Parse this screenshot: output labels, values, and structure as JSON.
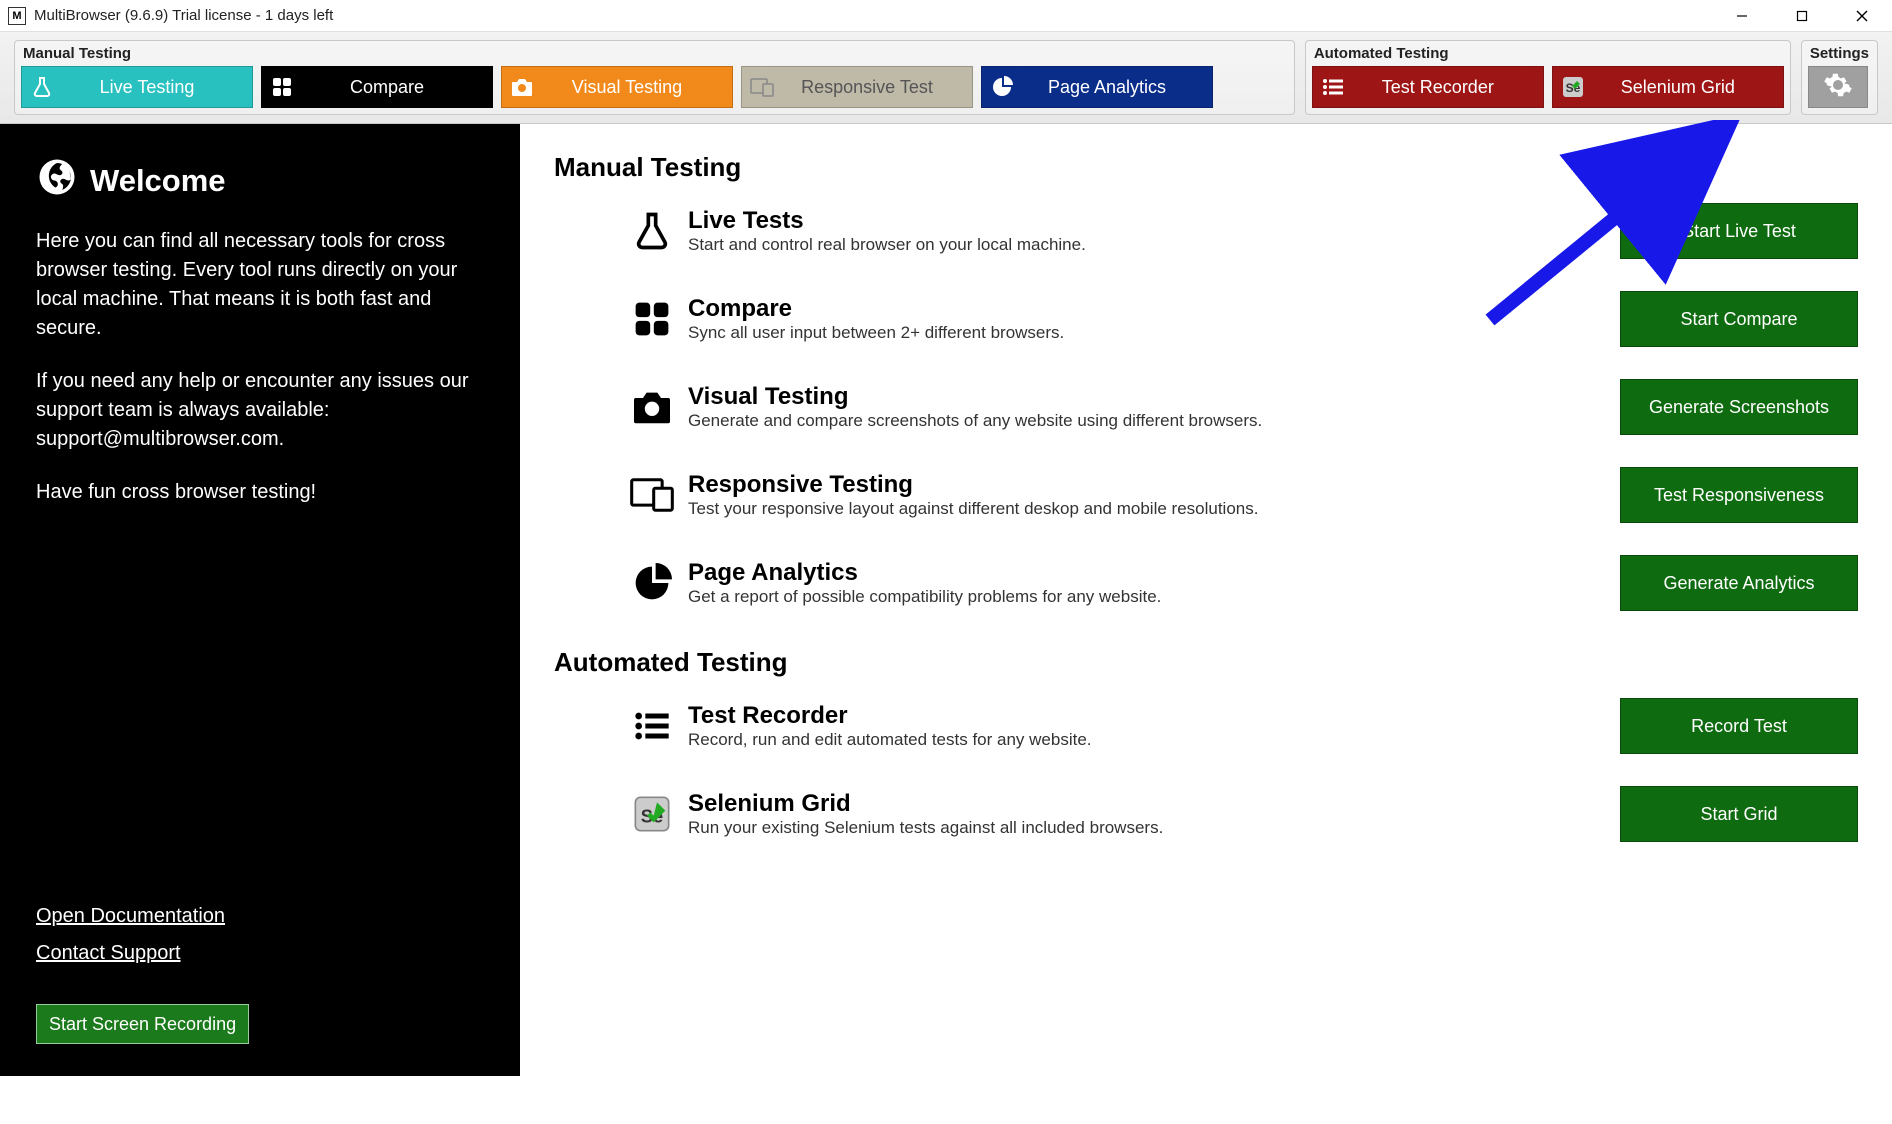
{
  "window": {
    "title": "MultiBrowser (9.6.9) Trial license - 1 days left"
  },
  "ribbon": {
    "manual": {
      "label": "Manual Testing",
      "buttons": {
        "live": "Live Testing",
        "compare": "Compare",
        "visual": "Visual Testing",
        "responsive": "Responsive Test",
        "analytics": "Page Analytics"
      }
    },
    "automated": {
      "label": "Automated Testing",
      "buttons": {
        "recorder": "Test Recorder",
        "selenium": "Selenium Grid"
      }
    },
    "settings": {
      "label": "Settings"
    }
  },
  "sidebar": {
    "welcome": "Welcome",
    "p1": "Here you can find all necessary tools for cross browser testing. Every tool runs directly on your local machine. That means it is both fast and secure.",
    "p2": "If you need any help or encounter any issues our support team is always available: support@multibrowser.com.",
    "p3": "Have fun cross browser testing!",
    "link_docs": "Open Documentation",
    "link_support": "Contact Support",
    "record_btn": "Start Screen Recording"
  },
  "main": {
    "manual_heading": "Manual Testing",
    "automated_heading": "Automated Testing",
    "features": {
      "live": {
        "title": "Live Tests",
        "desc": "Start and control real browser on your local machine.",
        "action": "Start Live Test"
      },
      "compare": {
        "title": "Compare",
        "desc": "Sync all user input between 2+ different browsers.",
        "action": "Start Compare"
      },
      "visual": {
        "title": "Visual Testing",
        "desc": "Generate and compare screenshots of any website using different browsers.",
        "action": "Generate Screenshots"
      },
      "responsive": {
        "title": "Responsive Testing",
        "desc": "Test your responsive layout against different deskop and mobile resolutions.",
        "action": "Test Responsiveness"
      },
      "analytics": {
        "title": "Page Analytics",
        "desc": "Get a report of possible compatibility problems for any website.",
        "action": "Generate Analytics"
      },
      "recorder": {
        "title": "Test Recorder",
        "desc": "Record, run and edit automated tests for any website.",
        "action": "Record Test"
      },
      "selenium": {
        "title": "Selenium Grid",
        "desc": "Run your existing Selenium tests against all included browsers.",
        "action": "Start Grid"
      }
    }
  }
}
